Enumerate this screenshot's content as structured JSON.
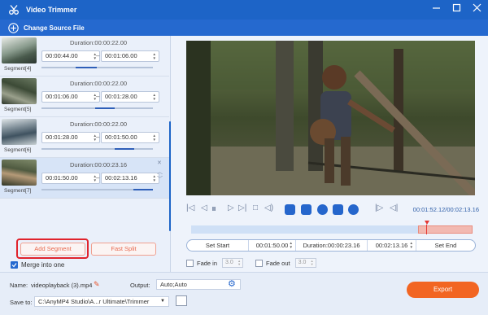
{
  "window": {
    "title": "Video Trimmer"
  },
  "toolbar": {
    "change_source": "Change Source File"
  },
  "segments": [
    {
      "name": "Segment[4]",
      "duration": "Duration:00:00:22.00",
      "start": "00:00:44.00",
      "end": "00:01:06.00"
    },
    {
      "name": "Segment[5]",
      "duration": "Duration:00:00:22.00",
      "start": "00:01:06.00",
      "end": "00:01:28.00"
    },
    {
      "name": "Segment[6]",
      "duration": "Duration:00:00:22.00",
      "start": "00:01:28.00",
      "end": "00:01:50.00"
    },
    {
      "name": "Segment[7]",
      "duration": "Duration:00:00:23.16",
      "start": "00:01:50.00",
      "end": "00:02:13.16",
      "selected": true
    }
  ],
  "actions": {
    "add_segment": "Add Segment",
    "fast_split": "Fast Split",
    "merge_into_one": "Merge into one"
  },
  "playback": {
    "time_display": "00:01:52.12/00:02:13.16"
  },
  "trim": {
    "set_start": "Set Start",
    "start_time": "00:01:50.00",
    "duration": "Duration:00:00:23.16",
    "end_time": "00:02:13.16",
    "set_end": "Set End"
  },
  "fade": {
    "fade_in_label": "Fade in",
    "fade_in_value": "3.0",
    "fade_out_label": "Fade out",
    "fade_out_value": "3.0"
  },
  "output": {
    "name_label": "Name:",
    "name_value": "videoplayback (3).mp4",
    "output_label": "Output:",
    "output_value": "Auto;Auto",
    "save_label": "Save to:",
    "save_path": "C:\\AnyMP4 Studio\\A...r Ultimate\\Trimmer",
    "export": "Export"
  },
  "colors": {
    "brand_blue": "#1d64c7",
    "export_orange": "#f26522",
    "highlight_red": "#e0232c"
  }
}
